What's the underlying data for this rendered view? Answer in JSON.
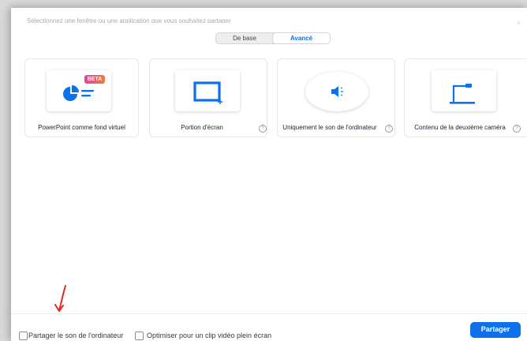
{
  "dialog": {
    "instruction": "Sélectionnez une fenêtre ou une application que vous souhaitez partager",
    "close_glyph": "×"
  },
  "tabs": [
    {
      "label": "De base",
      "active": false
    },
    {
      "label": "Avancé",
      "active": true
    }
  ],
  "cards": [
    {
      "label": "PowerPoint comme fond virtuel",
      "badge": "BETA",
      "icon": "powerpoint-background-icon"
    },
    {
      "label": "Portion d'écran",
      "icon": "screen-portion-icon",
      "help": "?"
    },
    {
      "label": "Uniquement le son de l'ordinateur",
      "icon": "speaker-icon",
      "help": "?"
    },
    {
      "label": "Contenu de la deuxième caméra",
      "icon": "document-camera-icon",
      "help": "?"
    }
  ],
  "footer": {
    "share_sound_label": "Partager le son de l'ordinateur",
    "optimize_label": "Optimiser pour un clip vidéo plein écran",
    "share_button": "Partager"
  },
  "colors": {
    "accent": "#0e71eb",
    "annotation_arrow": "#e02a1f",
    "beta_badge_start": "#e0469d",
    "beta_badge_end": "#f07a3c"
  }
}
